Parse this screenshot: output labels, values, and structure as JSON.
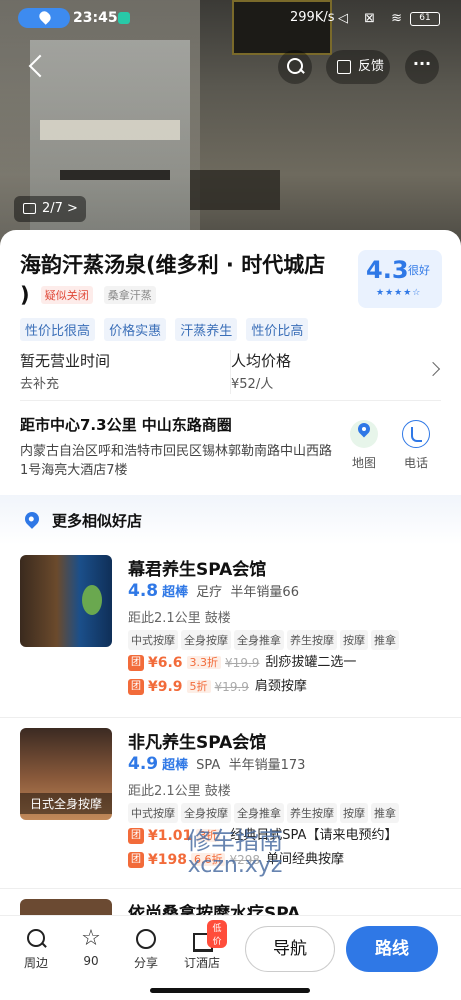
{
  "status_bar": {
    "time": "23:45",
    "network": "299K/s",
    "icons": "◁ ⊠ ≋",
    "battery": "61"
  },
  "header": {
    "feedback_label": "反馈",
    "more_label": "···",
    "photo_counter": "2/7 >"
  },
  "place": {
    "title_line1": "海韵汗蒸汤泉(维多利 · 时代城店",
    "title_line2": ")",
    "status_tag": "疑似关闭",
    "category": "桑拿汗蒸",
    "rating": "4.3",
    "rating_label": "很好",
    "stars": "★★★★☆",
    "tags": [
      "性价比很高",
      "价格实惠",
      "汗蒸养生",
      "性价比高"
    ],
    "hours_title": "暂无营业时间",
    "hours_sub": "去补充",
    "price_title": "人均价格",
    "price_value": "¥52/人",
    "distance": "距市中心7.3公里   中山东路商圈",
    "address": "内蒙古自治区呼和浩特市回民区锡林郭勒南路中山西路1号海亮大酒店7楼",
    "map_label": "地图",
    "phone_label": "电话"
  },
  "similar": {
    "header": "更多相似好店",
    "shops": [
      {
        "name": "幕君养生SPA会馆",
        "rating": "4.8",
        "level": "超棒",
        "type": "足疗",
        "sales": "半年销量66",
        "distance": "距此2.1公里    鼓楼",
        "tags": [
          "中式按摩",
          "全身按摩",
          "全身推拿",
          "养生按摩",
          "按摩",
          "推拿"
        ],
        "deals": [
          {
            "badge": "团",
            "price": "¥6.6",
            "discount": "3.3折",
            "original": "¥19.9",
            "name": "刮痧拔罐二选一"
          },
          {
            "badge": "团",
            "price": "¥9.9",
            "discount": "5折",
            "original": "¥19.9",
            "name": "肩颈按摩"
          }
        ]
      },
      {
        "name": "非凡养生SPA会馆",
        "rating": "4.9",
        "level": "超棒",
        "type": "SPA",
        "sales": "半年销量173",
        "distance": "距此2.1公里    鼓楼",
        "thumb_caption": "日式全身按摩",
        "tags": [
          "中式按摩",
          "全身按摩",
          "全身推拿",
          "养生按摩",
          "按摩",
          "推拿"
        ],
        "deals": [
          {
            "badge": "团",
            "price": "¥1.01",
            "discount": "3折",
            "original": "",
            "name": "经典日式SPA【请来电预约】"
          },
          {
            "badge": "团",
            "price": "¥198",
            "discount": "6.6折",
            "original": "¥298",
            "name": "单间经典按摩"
          }
        ]
      },
      {
        "name": "依尚桑拿按摩水疗SPA"
      }
    ]
  },
  "watermark": {
    "line1": "修车指南",
    "line2": "xczn.xyz"
  },
  "bottom_bar": {
    "nearby": "周边",
    "favorites_count": "90",
    "share": "分享",
    "hotel": "订酒店",
    "hotel_badge": "低价",
    "navigate": "导航",
    "route": "路线"
  }
}
